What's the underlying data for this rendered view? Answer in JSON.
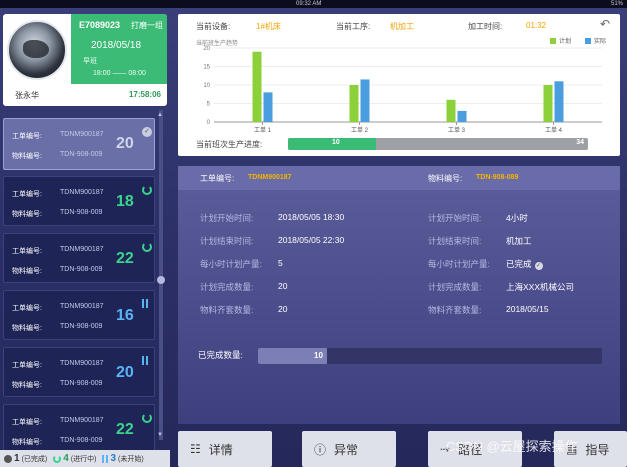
{
  "statusbar": {
    "time": "09:32 AM",
    "battery": "51%"
  },
  "profile": {
    "employee_code": "E7089023",
    "team": "打磨一组",
    "date": "2018/05/18",
    "shift": "早班",
    "shift_time": "18:00 —— 08:00",
    "name": "张永华",
    "clock": "17:58:06"
  },
  "cards": [
    {
      "order_label": "工单编号:",
      "order_no": "TDNM900187",
      "material_label": "物料编号:",
      "material_no": "TDN-908-009",
      "count": "20",
      "status": "done"
    },
    {
      "order_label": "工单编号:",
      "order_no": "TDNM900187",
      "material_label": "物料编号:",
      "material_no": "TDN-908-009",
      "count": "18",
      "status": "in-progress"
    },
    {
      "order_label": "工单编号:",
      "order_no": "TDNM900187",
      "material_label": "物料编号:",
      "material_no": "TDN-908-009",
      "count": "22",
      "status": "in-progress"
    },
    {
      "order_label": "工单编号:",
      "order_no": "TDNM900187",
      "material_label": "物料编号:",
      "material_no": "TDN-908-009",
      "count": "16",
      "status": "not-started"
    },
    {
      "order_label": "工单编号:",
      "order_no": "TDNM900187",
      "material_label": "物料编号:",
      "material_no": "TDN-908-009",
      "count": "20",
      "status": "not-started"
    },
    {
      "order_label": "工单编号:",
      "order_no": "TDNM900187",
      "material_label": "物料编号:",
      "material_no": "TDN-908-009",
      "count": "22",
      "status": "in-progress"
    }
  ],
  "legend": {
    "done_count": "1",
    "done_label": "(已完成)",
    "progress_count": "4",
    "progress_label": "(进行中)",
    "notstarted_count": "3",
    "notstarted_label": "(未开始)"
  },
  "info": {
    "device_label": "当前设备:",
    "device_value": "1#机床",
    "process_label": "当前工序:",
    "process_value": "机加工",
    "time_label": "加工时间:",
    "time_value": "01:32"
  },
  "chart_data": {
    "type": "bar",
    "title": "当前班生产趋势",
    "categories": [
      "工单 1",
      "工单 2",
      "工单 3",
      "工单 4"
    ],
    "series": [
      {
        "name": "计划",
        "color": "#8cd13a",
        "values": [
          19,
          10,
          6,
          10
        ]
      },
      {
        "name": "实际",
        "color": "#4a9ee0",
        "values": [
          8,
          11.5,
          3,
          11
        ]
      }
    ],
    "ylim": [
      0,
      20
    ],
    "yticks": [
      "0",
      "5",
      "10",
      "15",
      "20"
    ],
    "legend_position": "top-right"
  },
  "progress": {
    "label": "当前班次生产进度:",
    "done": "10",
    "total": "34",
    "fraction": 0.294
  },
  "detail": {
    "order_label": "工单编号:",
    "order_value": "TDNM900187",
    "material_label": "物料编号:",
    "material_value": "TDN-908-089",
    "rows_left": [
      {
        "k": "计划开始时间:",
        "v": "2018/05/05   18:30"
      },
      {
        "k": "计划结束时间:",
        "v": "2018/05/05   22:30"
      },
      {
        "k": "每小时计划产量:",
        "v": "5"
      },
      {
        "k": "计划完成数量:",
        "v": "20"
      },
      {
        "k": "物料齐套数量:",
        "v": "20"
      }
    ],
    "rows_right": [
      {
        "k": "计划开始时间:",
        "v": "4小时"
      },
      {
        "k": "计划结束时间:",
        "v": "机加工"
      },
      {
        "k": "每小时计划产量:",
        "v": "已完成"
      },
      {
        "k": "计划完成数量:",
        "v": "上海XXX机械公司"
      },
      {
        "k": "物料齐套数量:",
        "v": "2018/05/15"
      }
    ],
    "completed_label": "已完成数量:",
    "completed_value": "10",
    "completed_fraction": 0.2
  },
  "buttons": {
    "details": "详情",
    "exception": "异常",
    "route": "路径",
    "guide": "指导"
  },
  "watermark": "CSDN @云屋探索操作"
}
